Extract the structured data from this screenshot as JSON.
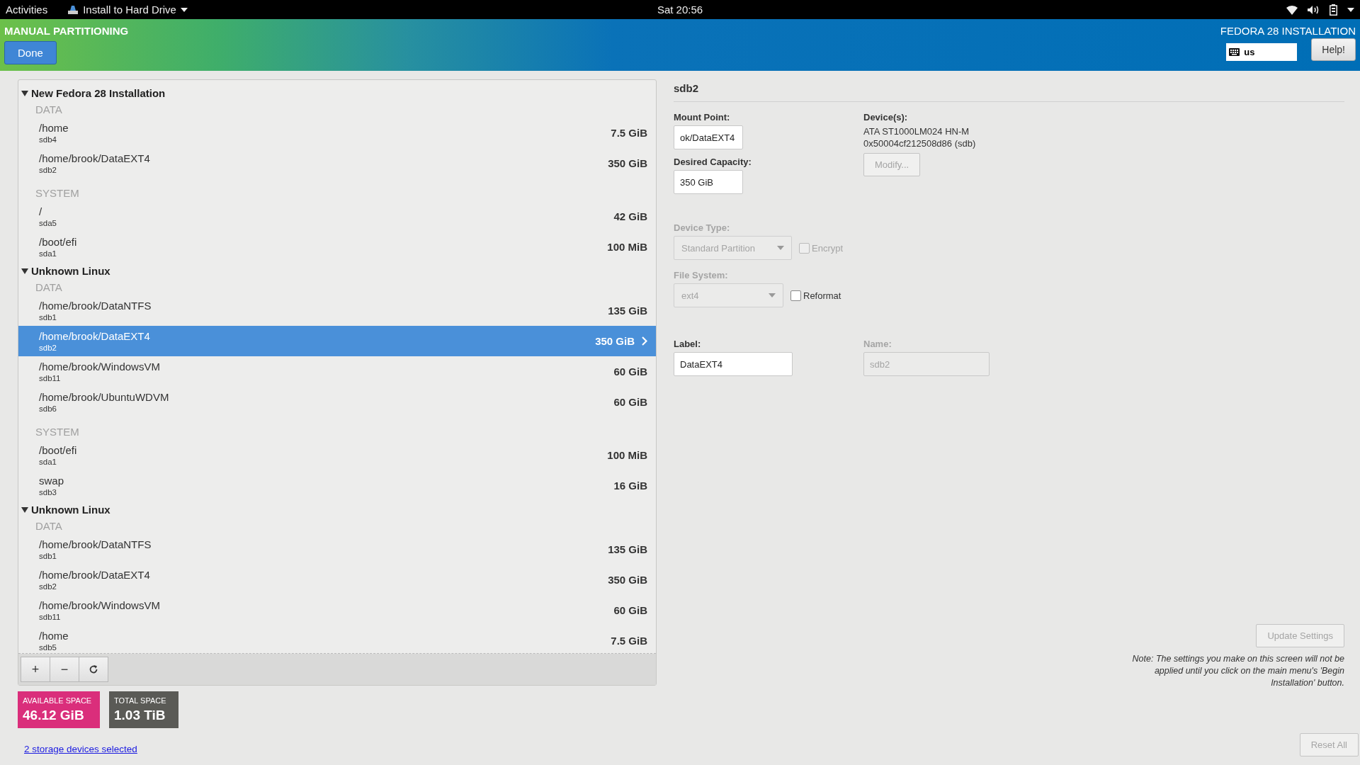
{
  "top_bar": {
    "activities": "Activities",
    "app_menu": "Install to Hard Drive",
    "clock": "Sat 20:56"
  },
  "header": {
    "title": "MANUAL PARTITIONING",
    "done_button": "Done",
    "product": "FEDORA 28 INSTALLATION",
    "keyboard_layout": "us",
    "help_button": "Help!"
  },
  "partition_list": {
    "groups": [
      {
        "name": "New Fedora 28 Installation",
        "expanded": true,
        "sections": [
          {
            "label": "DATA",
            "items": [
              {
                "mount": "/home",
                "device": "sdb4",
                "size": "7.5 GiB",
                "selected": false
              },
              {
                "mount": "/home/brook/DataEXT4",
                "device": "sdb2",
                "size": "350 GiB",
                "selected": false
              }
            ]
          },
          {
            "label": "SYSTEM",
            "items": [
              {
                "mount": "/",
                "device": "sda5",
                "size": "42 GiB",
                "selected": false
              },
              {
                "mount": "/boot/efi",
                "device": "sda1",
                "size": "100 MiB",
                "selected": false
              }
            ]
          }
        ]
      },
      {
        "name": "Unknown Linux",
        "expanded": true,
        "sections": [
          {
            "label": "DATA",
            "items": [
              {
                "mount": "/home/brook/DataNTFS",
                "device": "sdb1",
                "size": "135 GiB",
                "selected": false
              },
              {
                "mount": "/home/brook/DataEXT4",
                "device": "sdb2",
                "size": "350 GiB",
                "selected": true
              },
              {
                "mount": "/home/brook/WindowsVM",
                "device": "sdb11",
                "size": "60 GiB",
                "selected": false
              },
              {
                "mount": "/home/brook/UbuntuWDVM",
                "device": "sdb6",
                "size": "60 GiB",
                "selected": false
              }
            ]
          },
          {
            "label": "SYSTEM",
            "items": [
              {
                "mount": "/boot/efi",
                "device": "sda1",
                "size": "100 MiB",
                "selected": false
              },
              {
                "mount": "swap",
                "device": "sdb3",
                "size": "16 GiB",
                "selected": false
              }
            ]
          }
        ]
      },
      {
        "name": "Unknown Linux",
        "expanded": true,
        "sections": [
          {
            "label": "DATA",
            "items": [
              {
                "mount": "/home/brook/DataNTFS",
                "device": "sdb1",
                "size": "135 GiB",
                "selected": false
              },
              {
                "mount": "/home/brook/DataEXT4",
                "device": "sdb2",
                "size": "350 GiB",
                "selected": false
              },
              {
                "mount": "/home/brook/WindowsVM",
                "device": "sdb11",
                "size": "60 GiB",
                "selected": false
              },
              {
                "mount": "/home",
                "device": "sdb5",
                "size": "7.5 GiB",
                "selected": false
              }
            ]
          }
        ]
      }
    ],
    "toolbar": [
      {
        "kind": "add",
        "label": "+"
      },
      {
        "kind": "remove",
        "label": "−"
      },
      {
        "kind": "refresh"
      }
    ]
  },
  "space": {
    "available_label": "AVAILABLE SPACE",
    "available": "46.12 GiB",
    "total_label": "TOTAL SPACE",
    "total": "1.03 TiB"
  },
  "storage_link": "2 storage devices selected",
  "details": {
    "title": "sdb2",
    "mount_point": {
      "label": "Mount Point:",
      "value": "ok/DataEXT4"
    },
    "desired_capacity": {
      "label": "Desired Capacity:",
      "value": "350 GiB"
    },
    "devices": {
      "label": "Device(s):",
      "lines": [
        "ATA ST1000LM024 HN-M",
        "0x50004cf212508d86 (sdb)"
      ],
      "modify_button": "Modify...",
      "modify_disabled": true
    },
    "device_type": {
      "label": "Device Type:",
      "value": "Standard Partition",
      "disabled": true,
      "encrypt_label": "Encrypt",
      "encrypt_checked": false,
      "encrypt_disabled": true
    },
    "file_system": {
      "label": "File System:",
      "value": "ext4",
      "disabled": true,
      "reformat_label": "Reformat",
      "reformat_checked": false
    },
    "label_field": {
      "label": "Label:",
      "value": "DataEXT4"
    },
    "name_field": {
      "label": "Name:",
      "value": "sdb2",
      "disabled": true
    },
    "update_button": "Update Settings",
    "update_disabled": true,
    "note": "Note:  The settings you make on this screen will not be applied until you click on the main menu's 'Begin Installation' button.",
    "reset_button": "Reset All",
    "reset_disabled": true
  }
}
